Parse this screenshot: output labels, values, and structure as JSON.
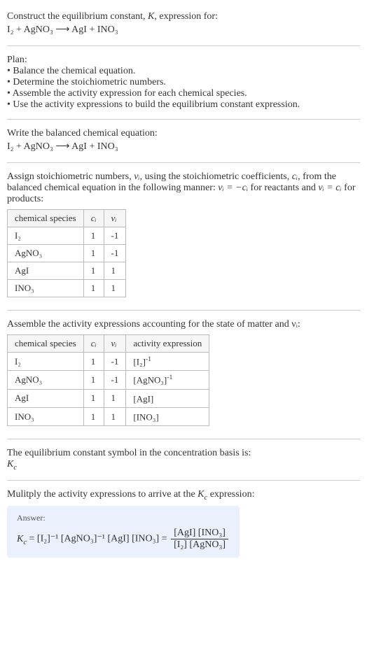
{
  "intro": {
    "line1": "Construct the equilibrium constant, ",
    "K": "K",
    "line1b": ", expression for:",
    "equation": "I₂ + AgNO₃ ⟶ AgI + INO₃"
  },
  "plan": {
    "title": "Plan:",
    "items": [
      "Balance the chemical equation.",
      "Determine the stoichiometric numbers.",
      "Assemble the activity expression for each chemical species.",
      "Use the activity expressions to build the equilibrium constant expression."
    ]
  },
  "balanced": {
    "title": "Write the balanced chemical equation:",
    "equation": "I₂ + AgNO₃ ⟶ AgI + INO₃"
  },
  "stoich": {
    "intro_a": "Assign stoichiometric numbers, ",
    "nu": "νᵢ",
    "intro_b": ", using the stoichiometric coefficients, ",
    "ci": "cᵢ",
    "intro_c": ", from the balanced chemical equation in the following manner: ",
    "rel1": "νᵢ = −cᵢ",
    "intro_d": " for reactants and ",
    "rel2": "νᵢ = cᵢ",
    "intro_e": " for products:",
    "headers": [
      "chemical species",
      "cᵢ",
      "νᵢ"
    ],
    "rows": [
      [
        "I₂",
        "1",
        "-1"
      ],
      [
        "AgNO₃",
        "1",
        "-1"
      ],
      [
        "AgI",
        "1",
        "1"
      ],
      [
        "INO₃",
        "1",
        "1"
      ]
    ]
  },
  "activity": {
    "intro": "Assemble the activity expressions accounting for the state of matter and νᵢ:",
    "headers": [
      "chemical species",
      "cᵢ",
      "νᵢ",
      "activity expression"
    ],
    "rows": [
      {
        "sp": "I₂",
        "c": "1",
        "v": "-1",
        "ae_base": "[I₂]",
        "ae_sup": "-1"
      },
      {
        "sp": "AgNO₃",
        "c": "1",
        "v": "-1",
        "ae_base": "[AgNO₃]",
        "ae_sup": "-1"
      },
      {
        "sp": "AgI",
        "c": "1",
        "v": "1",
        "ae_base": "[AgI]",
        "ae_sup": ""
      },
      {
        "sp": "INO₃",
        "c": "1",
        "v": "1",
        "ae_base": "[INO₃]",
        "ae_sup": ""
      }
    ]
  },
  "symbol": {
    "line": "The equilibrium constant symbol in the concentration basis is:",
    "Kc": "K",
    "Kc_sub": "c"
  },
  "final": {
    "line": "Mulitply the activity expressions to arrive at the ",
    "Kc": "K",
    "Kc_sub": "c",
    "line_b": " expression:",
    "answer_label": "Answer:",
    "lhs_K": "K",
    "lhs_K_sub": "c",
    "mid": " = [I₂]⁻¹ [AgNO₃]⁻¹ [AgI] [INO₃] = ",
    "frac_num": "[AgI] [INO₃]",
    "frac_den": "[I₂] [AgNO₃]"
  }
}
